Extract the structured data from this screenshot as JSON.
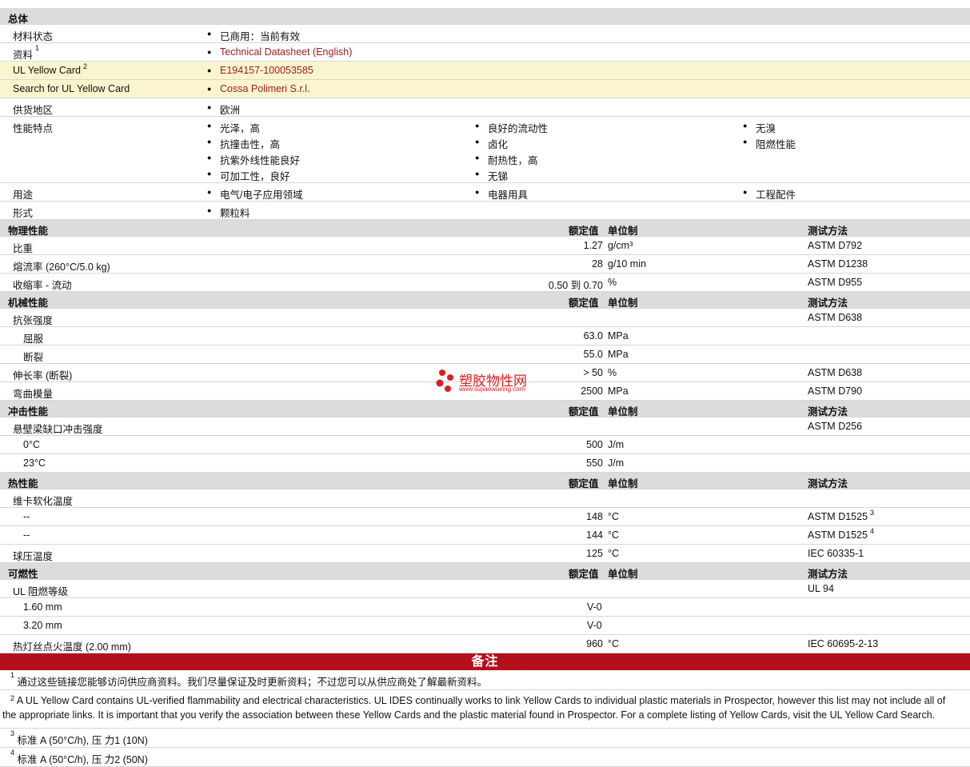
{
  "general": {
    "header": "总体",
    "material_status": {
      "label": "材料状态",
      "value": "已商用：当前有效"
    },
    "documents": {
      "label": "资料",
      "sup": "1",
      "value": "Technical Datasheet (English)"
    },
    "ul_card": {
      "label": "UL Yellow Card",
      "sup": "2",
      "value": "E194157-100053585"
    },
    "ul_search": {
      "label": "Search for UL Yellow Card",
      "value": "Cossa Polimeri S.r.l."
    },
    "region": {
      "label": "供货地区",
      "value": "欧洲"
    },
    "features": {
      "label": "性能特点",
      "col1": [
        "光泽，高",
        "抗撞击性，高",
        "抗紫外线性能良好",
        "可加工性，良好"
      ],
      "col2": [
        "良好的流动性",
        "卤化",
        "耐热性，高",
        "无锑"
      ],
      "col3": [
        "无溴",
        "阻燃性能"
      ]
    },
    "uses": {
      "label": "用途",
      "items": [
        "电气/电子应用领域",
        "电器用具",
        "工程配件"
      ]
    },
    "form": {
      "label": "形式",
      "value": "颗粒料"
    }
  },
  "col_headers": {
    "value": "额定值",
    "unit": "单位制",
    "method": "测试方法"
  },
  "physical": {
    "header": "物理性能",
    "rows": [
      {
        "label": "比重",
        "value": "1.27",
        "unit": "g/cm³",
        "method": "ASTM D792"
      },
      {
        "label": "熔流率 (260°C/5.0 kg)",
        "value": "28",
        "unit": "g/10 min",
        "method": "ASTM D1238"
      },
      {
        "label": "收缩率 - 流动",
        "value": "0.50 到 0.70",
        "unit": "%",
        "method": "ASTM D955"
      }
    ]
  },
  "mechanical": {
    "header": "机械性能",
    "tensile": {
      "label": "抗张强度",
      "method": "ASTM D638"
    },
    "yield": {
      "label": "屈服",
      "value": "63.0",
      "unit": "MPa"
    },
    "break": {
      "label": "断裂",
      "value": "55.0",
      "unit": "MPa"
    },
    "elong": {
      "label": "伸长率 (断裂)",
      "value": "> 50",
      "unit": "%",
      "method": "ASTM D638"
    },
    "flex": {
      "label": "弯曲模量",
      "value": "2500",
      "unit": "MPa",
      "method": "ASTM D790"
    }
  },
  "impact": {
    "header": "冲击性能",
    "izod": {
      "label": "悬壁梁缺口冲击强度",
      "method": "ASTM D256"
    },
    "r0": {
      "label": "0°C",
      "value": "500",
      "unit": "J/m"
    },
    "r23": {
      "label": "23°C",
      "value": "550",
      "unit": "J/m"
    }
  },
  "thermal": {
    "header": "热性能",
    "vicat": {
      "label": "维卡软化温度"
    },
    "v1": {
      "label": "--",
      "value": "148",
      "unit": "°C",
      "method": "ASTM D1525",
      "sup": "3"
    },
    "v2": {
      "label": "--",
      "value": "144",
      "unit": "°C",
      "method": "ASTM D1525",
      "sup": "4"
    },
    "ball": {
      "label": "球压温度",
      "value": "125",
      "unit": "°C",
      "method": "IEC 60335-1"
    }
  },
  "flammability": {
    "header": "可燃性",
    "ul": {
      "label": "UL 阻燃等级",
      "method": "UL 94"
    },
    "t1": {
      "label": "1.60 mm",
      "value": "V-0"
    },
    "t2": {
      "label": "3.20 mm",
      "value": "V-0"
    },
    "gwit": {
      "label": "热灯丝点火温度 (2.00 mm)",
      "value": "960",
      "unit": "°C",
      "method": "IEC 60695-2-13"
    }
  },
  "notes": {
    "header": "备注",
    "n1": {
      "sup": "1",
      "text": "通过这些链接您能够访问供应商资料。我们尽量保证及时更新资料；不过您可以从供应商处了解最新资料。"
    },
    "n2": {
      "sup": "2",
      "text1": "A UL Yellow Card contains UL-verified flammability and electrical characteristics. UL IDES continually works to link Yellow Cards to individual plastic materials in Prospector, however this list may not include all of",
      "text2": "the appropriate links. It is important that you verify the association between these Yellow Cards and the plastic material found in Prospector. For a complete listing of Yellow Cards, visit the UL Yellow Card Search."
    },
    "n3": {
      "sup": "3",
      "text": "标准 A (50°C/h), 压 力1 (10N)"
    },
    "n4": {
      "sup": "4",
      "text": "标准 A (50°C/h), 压 力2 (50N)"
    }
  },
  "watermark": {
    "title": "塑胶物性网",
    "url": "www.sujiaowuxing.com",
    "color": "#d92020"
  }
}
